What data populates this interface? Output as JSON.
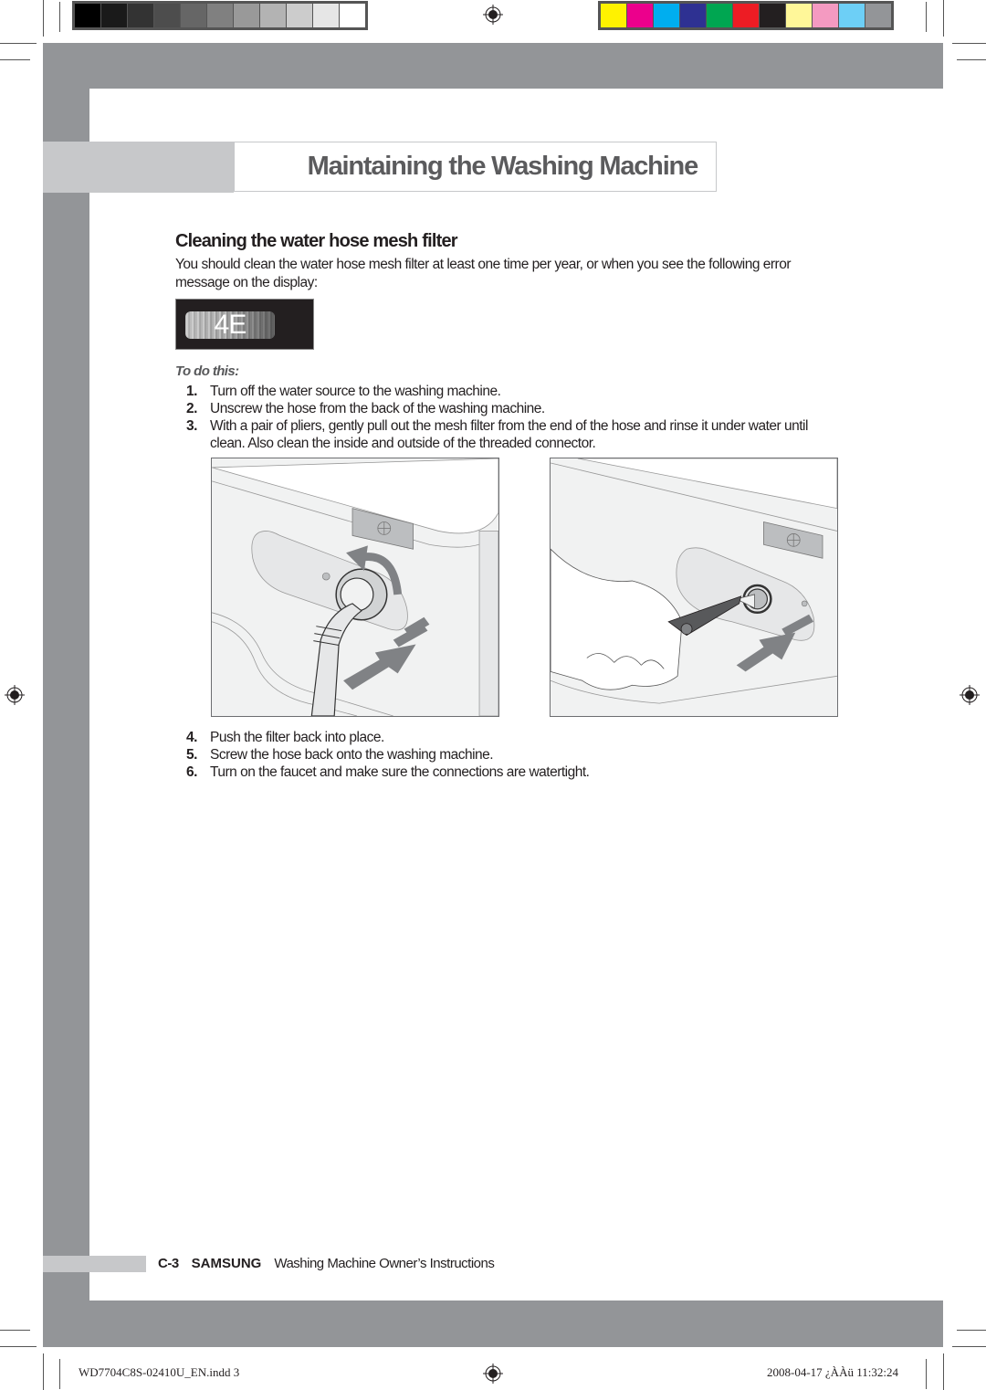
{
  "color_bars": {
    "grayscale": [
      "#000000",
      "#1a1a1a",
      "#333333",
      "#4d4d4d",
      "#666666",
      "#808080",
      "#999999",
      "#b3b3b3",
      "#cccccc",
      "#e6e6e6",
      "#ffffff"
    ],
    "process": [
      "#fff200",
      "#ec008c",
      "#00aeef",
      "#2e3192",
      "#00a651",
      "#ed1c24",
      "#231f20",
      "#fff799",
      "#f49ac1",
      "#6dcff6",
      "#939598"
    ]
  },
  "header": {
    "title": "Maintaining the Washing Machine"
  },
  "section": {
    "heading": "Cleaning the water hose mesh filter",
    "intro": "You should clean the water hose mesh filter at least one time per year, or when you see the following error message on the display:",
    "error_code": "4E",
    "todo_label": "To do this:",
    "steps_before": [
      {
        "num": "1.",
        "text": "Turn off the water source to the washing machine."
      },
      {
        "num": "2.",
        "text": "Unscrew the hose from the back of the washing machine."
      },
      {
        "num": "3.",
        "text": "With a pair of pliers, gently pull out the mesh filter from the end of the hose and rinse it under water until clean. Also clean the inside and outside of the threaded connector."
      }
    ],
    "illustrations": [
      {
        "name": "unscrew-hose-illustration",
        "depicts": "hose being unscrewed from water inlet with rotate and pull arrows"
      },
      {
        "name": "pliers-filter-illustration",
        "depicts": "hand using pliers to pull mesh filter from threaded connector"
      }
    ],
    "steps_after": [
      {
        "num": "4.",
        "text": "Push the filter back into place."
      },
      {
        "num": "5.",
        "text": "Screw the hose back onto the washing machine."
      },
      {
        "num": "6.",
        "text": "Turn on the faucet and make sure the connections are watertight."
      }
    ]
  },
  "footer": {
    "page_number": "C-3",
    "brand": "SAMSUNG",
    "doc_title": "Washing Machine Owner’s Instructions"
  },
  "slug": {
    "file": "WD7704C8S-02410U_EN.indd   3",
    "timestamp": "2008-04-17   ¿ÀÀü 11:32:24"
  },
  "colors": {
    "frame_grey": "#939598",
    "tab_light_grey": "#c7c8ca",
    "title_grey": "#5b5b5d",
    "text": "#231f20"
  }
}
